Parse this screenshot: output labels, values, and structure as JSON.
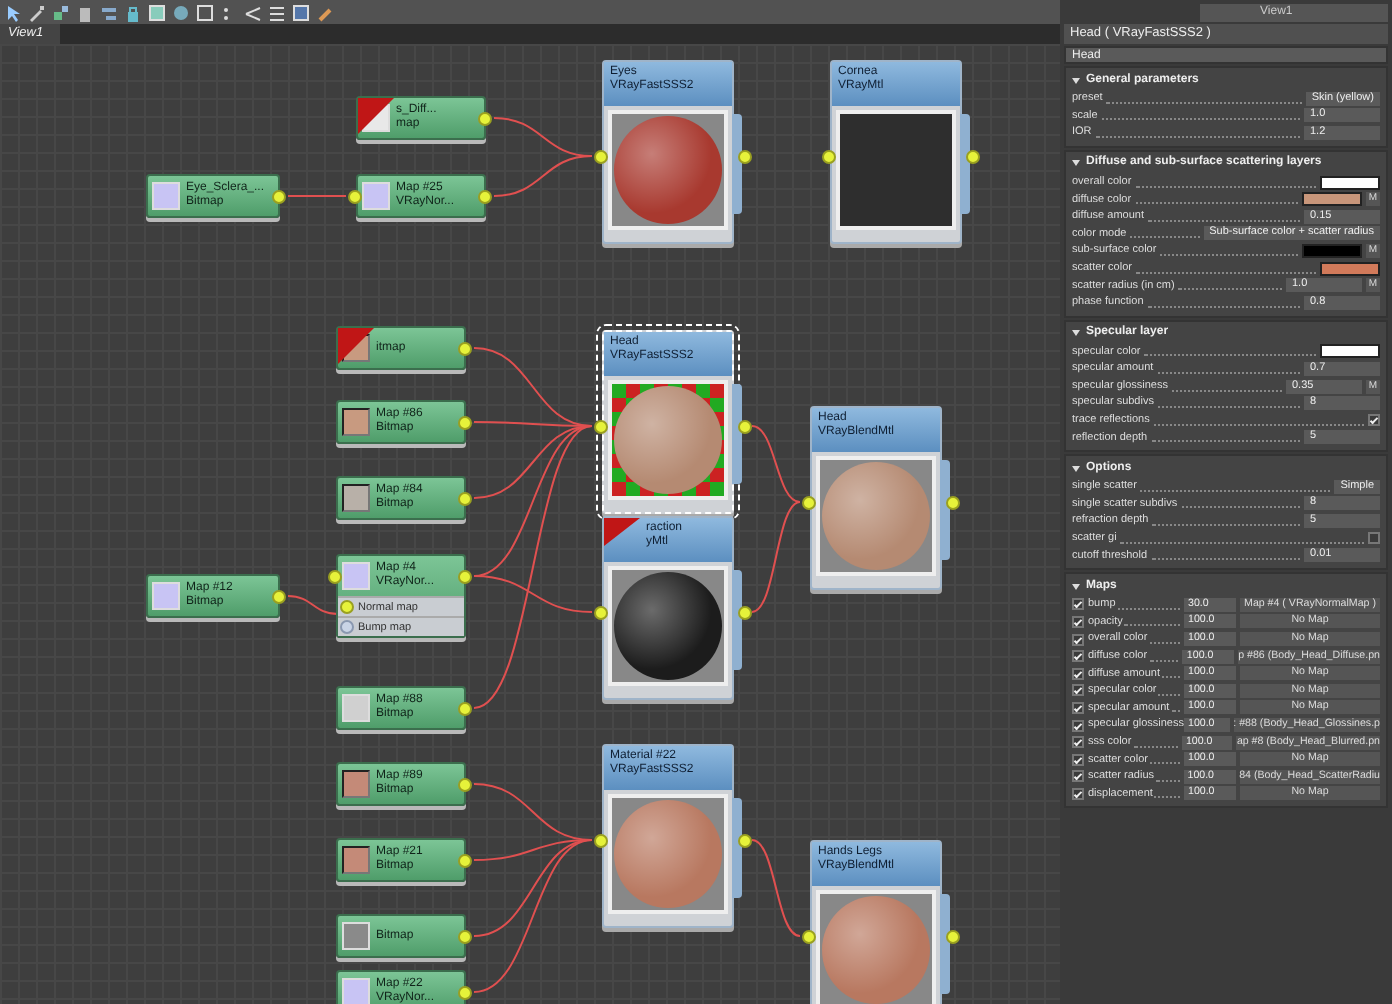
{
  "canvas_tab": {
    "label": "View1"
  },
  "canvas": {
    "nodes": [
      {
        "kind": "map",
        "title": "s_Diff...",
        "subtitle": "map",
        "flagged": true,
        "selected": false,
        "thumbnail": {
          "kind": "swatch",
          "color": "#e8e8e8"
        }
      },
      {
        "kind": "map",
        "title": "Eye_Sclera_...",
        "subtitle": "Bitmap",
        "flagged": false,
        "selected": false,
        "thumbnail": {
          "kind": "swatch",
          "color": "#c8c4f4"
        }
      },
      {
        "kind": "map",
        "title": "Map #25",
        "subtitle": "VRayNor...",
        "flagged": false,
        "selected": false,
        "thumbnail": {
          "kind": "swatch",
          "color": "#c8c4f4"
        }
      },
      {
        "kind": "material",
        "title": "Eyes",
        "subtitle": "VRayFastSSS2",
        "flagged": false,
        "selected": false,
        "preview": {
          "kind": "sphere",
          "color": "#a8392f"
        }
      },
      {
        "kind": "material",
        "title": "Cornea",
        "subtitle": "VRayMtl",
        "flagged": false,
        "selected": false,
        "preview": {
          "kind": "empty",
          "color": "#2e2e2e"
        }
      },
      {
        "kind": "map",
        "title": "itmap",
        "flagged": true,
        "selected": false,
        "thumbnail": {
          "kind": "photo",
          "color": "#c89a80"
        }
      },
      {
        "kind": "map",
        "title": "Map #86",
        "subtitle": "Bitmap",
        "flagged": false,
        "selected": false,
        "thumbnail": {
          "kind": "photo",
          "color": "#c89a80"
        }
      },
      {
        "kind": "map",
        "title": "Map #84",
        "subtitle": "Bitmap",
        "flagged": false,
        "selected": false,
        "thumbnail": {
          "kind": "photo",
          "color": "#b8b0a8"
        }
      },
      {
        "kind": "map",
        "title": "Map #12",
        "subtitle": "Bitmap",
        "flagged": false,
        "selected": false,
        "thumbnail": {
          "kind": "swatch",
          "color": "#c8c4f4"
        }
      },
      {
        "kind": "map",
        "title": "Map #4",
        "subtitle": "VRayNor...",
        "flagged": false,
        "selected": false,
        "thumbnail": {
          "kind": "swatch",
          "color": "#c8c4f4"
        },
        "slots": [
          {
            "label": "Normal map",
            "connected": true
          },
          {
            "label": "Bump map",
            "connected": false
          }
        ]
      },
      {
        "kind": "map",
        "title": "Map #88",
        "subtitle": "Bitmap",
        "flagged": false,
        "selected": false,
        "thumbnail": {
          "kind": "swatch",
          "color": "#d0d0d0"
        }
      },
      {
        "kind": "map",
        "title": "Map #89",
        "subtitle": "Bitmap",
        "flagged": false,
        "selected": false,
        "thumbnail": {
          "kind": "photo",
          "color": "#c48a78"
        }
      },
      {
        "kind": "map",
        "title": "Map #21",
        "subtitle": "Bitmap",
        "flagged": false,
        "selected": false,
        "thumbnail": {
          "kind": "photo",
          "color": "#c48a78"
        }
      },
      {
        "kind": "map",
        "title": "Bitmap",
        "flagged": false,
        "selected": false,
        "thumbnail": {
          "kind": "swatch",
          "color": "#8a8a8a"
        }
      },
      {
        "kind": "map",
        "title": "Map #22",
        "subtitle": "VRayNor...",
        "flagged": false,
        "selected": false,
        "thumbnail": {
          "kind": "swatch",
          "color": "#c8c4f4"
        }
      },
      {
        "kind": "material",
        "title": "Head",
        "subtitle": "VRayFastSSS2",
        "flagged": false,
        "selected": true,
        "preview": {
          "kind": "checker",
          "color": "#b58a72"
        }
      },
      {
        "kind": "material",
        "title": "raction",
        "subtitle": "yMtl",
        "flagged": true,
        "selected": false,
        "preview": {
          "kind": "sphere",
          "color": "#1c1c1c"
        }
      },
      {
        "kind": "material",
        "title": "Head",
        "subtitle": "VRayBlendMtl",
        "flagged": false,
        "selected": false,
        "preview": {
          "kind": "sphere",
          "color": "#b58a72"
        }
      },
      {
        "kind": "material",
        "title": "Material #22",
        "subtitle": "VRayFastSSS2",
        "flagged": false,
        "selected": false,
        "preview": {
          "kind": "sphere",
          "color": "#b87860"
        }
      },
      {
        "kind": "material",
        "title": "Hands Legs",
        "subtitle": "VRayBlendMtl",
        "flagged": false,
        "selected": false,
        "preview": {
          "kind": "sphere",
          "color": "#b87860"
        }
      }
    ]
  },
  "panel": {
    "view": "View1",
    "header": "Head  ( VRayFastSSS2 )",
    "name_field": "Head",
    "rollouts": [
      {
        "title": "General parameters",
        "expanded": true,
        "params": [
          {
            "kind": "dropdown",
            "label": "preset",
            "value": "Skin (yellow)"
          },
          {
            "kind": "spinner",
            "label": "scale",
            "value": "1.0"
          },
          {
            "kind": "spinner",
            "label": "IOR",
            "value": "1.2"
          }
        ]
      },
      {
        "title": "Diffuse and sub-surface scattering layers",
        "expanded": true,
        "params": [
          {
            "kind": "color",
            "label": "overall color",
            "color": "#ffffff"
          },
          {
            "kind": "color",
            "label": "diffuse color",
            "color": "#c8967a",
            "map_button": "M"
          },
          {
            "kind": "spinner",
            "label": "diffuse amount",
            "value": "0.15"
          },
          {
            "kind": "dropdown",
            "label": "color mode",
            "value": "Sub-surface color + scatter radius"
          },
          {
            "kind": "color",
            "label": "sub-surface color",
            "color": "#000000",
            "map_button": "M"
          },
          {
            "kind": "color",
            "label": "scatter color",
            "color": "#d27a5a"
          },
          {
            "kind": "spinner",
            "label": "scatter radius (in cm)",
            "value": "1.0",
            "map_button": "M"
          },
          {
            "kind": "spinner",
            "label": "phase function",
            "value": "0.8"
          }
        ]
      },
      {
        "title": "Specular layer",
        "expanded": true,
        "params": [
          {
            "kind": "color",
            "label": "specular color",
            "color": "#ffffff"
          },
          {
            "kind": "spinner",
            "label": "specular amount",
            "value": "0.7"
          },
          {
            "kind": "spinner",
            "label": "specular glossiness",
            "value": "0.35",
            "map_button": "M"
          },
          {
            "kind": "spinner",
            "label": "specular subdivs",
            "value": "8"
          },
          {
            "kind": "check",
            "label": "trace reflections",
            "checked": true
          },
          {
            "kind": "spinner",
            "label": "reflection depth",
            "value": "5"
          }
        ]
      },
      {
        "title": "Options",
        "expanded": true,
        "params": [
          {
            "kind": "dropdown",
            "label": "single scatter",
            "value": "Simple"
          },
          {
            "kind": "spinner",
            "label": "single scatter subdivs",
            "value": "8"
          },
          {
            "kind": "spinner",
            "label": "refraction depth",
            "value": "5"
          },
          {
            "kind": "check",
            "label": "scatter gi",
            "checked": false
          },
          {
            "kind": "spinner",
            "label": "cutoff threshold",
            "value": "0.01"
          }
        ]
      },
      {
        "title": "Maps",
        "expanded": true,
        "params": [
          {
            "kind": "map",
            "label": "bump",
            "checked": true,
            "value": "30.0",
            "map": "Map #4  ( VRayNormalMap )"
          },
          {
            "kind": "map",
            "label": "opacity",
            "checked": true,
            "value": "100.0",
            "map": "No Map"
          },
          {
            "kind": "map",
            "label": "overall color",
            "checked": true,
            "value": "100.0",
            "map": "No Map"
          },
          {
            "kind": "map",
            "label": "diffuse color",
            "checked": true,
            "value": "100.0",
            "map": "p #86 (Body_Head_Diffuse.pn"
          },
          {
            "kind": "map",
            "label": "diffuse amount",
            "checked": true,
            "value": "100.0",
            "map": "No Map"
          },
          {
            "kind": "map",
            "label": "specular color",
            "checked": true,
            "value": "100.0",
            "map": "No Map"
          },
          {
            "kind": "map",
            "label": "specular amount",
            "checked": true,
            "value": "100.0",
            "map": "No Map"
          },
          {
            "kind": "map",
            "label": "specular glossiness",
            "checked": true,
            "value": "100.0",
            "map": ": #88 (Body_Head_Glossines.p"
          },
          {
            "kind": "map",
            "label": "sss color",
            "checked": true,
            "value": "100.0",
            "map": "ap #8 (Body_Head_Blurred.pn"
          },
          {
            "kind": "map",
            "label": "scatter color",
            "checked": true,
            "value": "100.0",
            "map": "No Map"
          },
          {
            "kind": "map",
            "label": "scatter radius",
            "checked": true,
            "value": "100.0",
            "map": "84 (Body_Head_ScatterRadiu"
          },
          {
            "kind": "map",
            "label": "displacement",
            "checked": true,
            "value": "100.0",
            "map": "No Map"
          }
        ]
      }
    ]
  }
}
